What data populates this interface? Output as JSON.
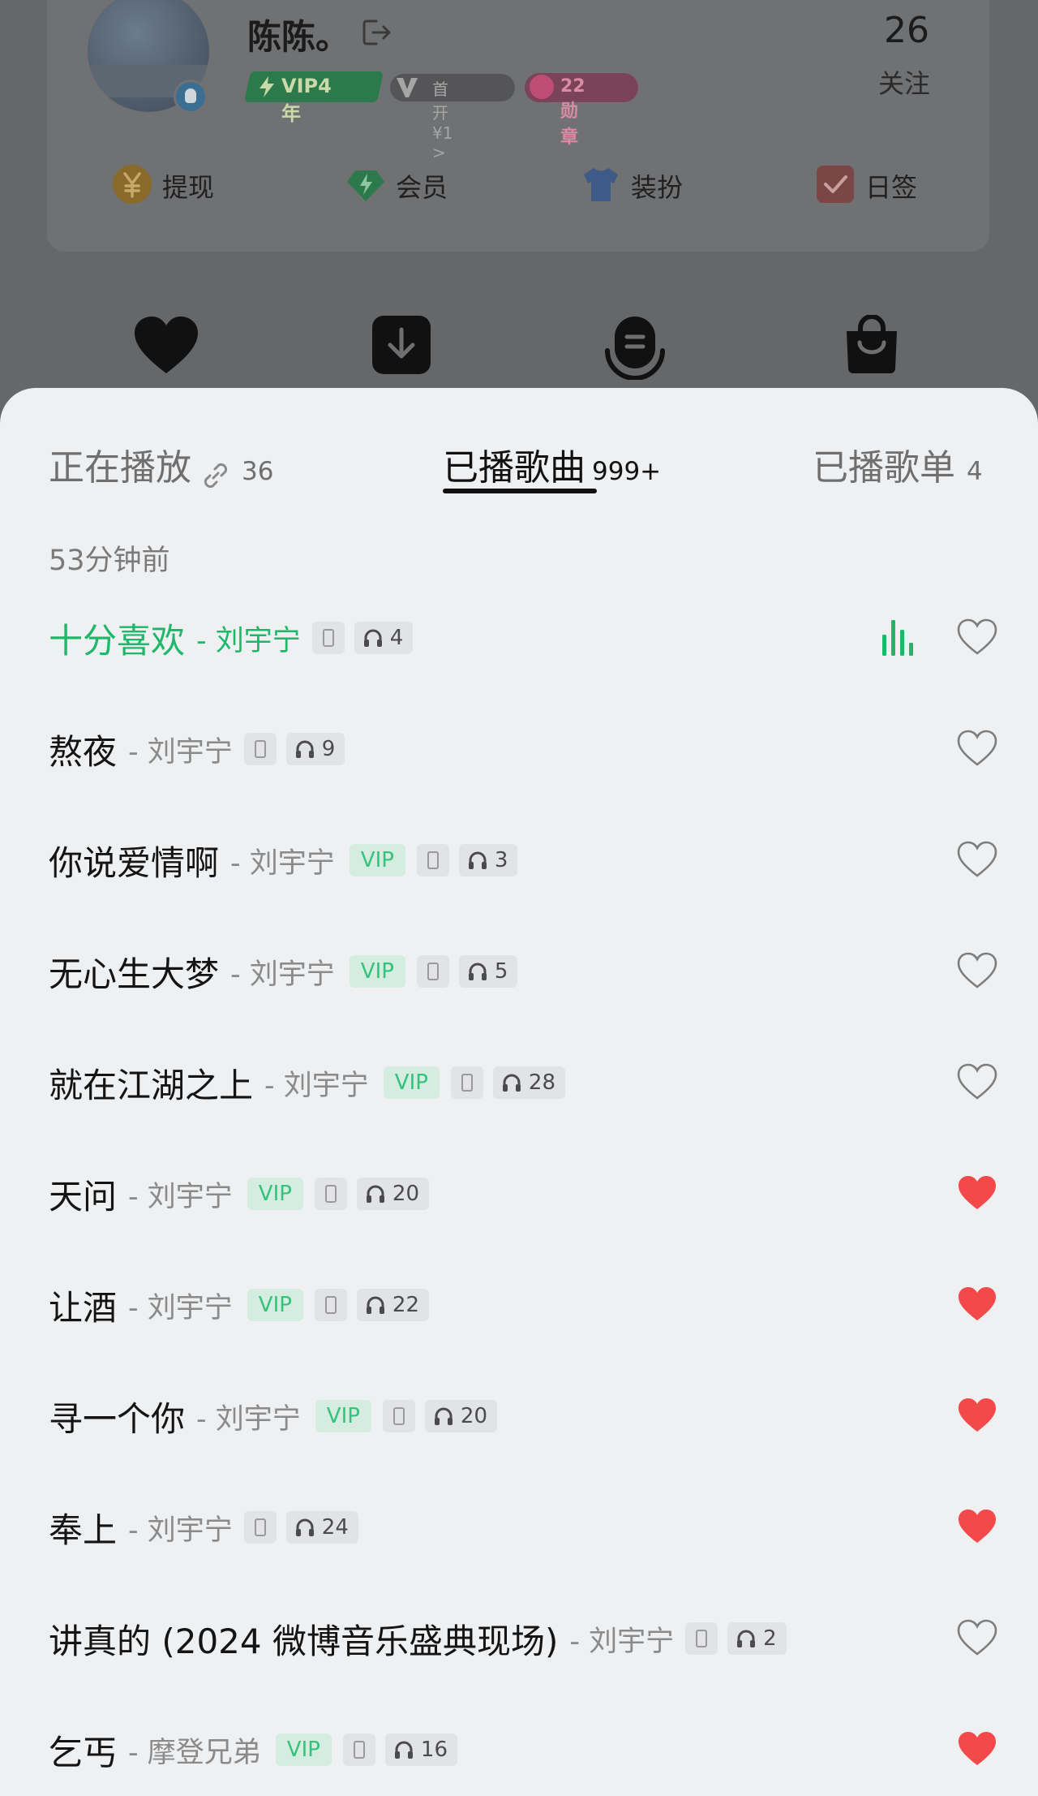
{
  "profile": {
    "username": "陈陈。",
    "vip_badge": "VIP4年",
    "v_badge": "首开¥1 >",
    "medal_badge": "22 勋章",
    "follow_count": "26",
    "follow_label": "关注"
  },
  "quick_actions": [
    {
      "label": "提现",
      "icon": "yuan-coin-icon"
    },
    {
      "label": "会员",
      "icon": "diamond-icon"
    },
    {
      "label": "装扮",
      "icon": "tshirt-icon"
    },
    {
      "label": "日签",
      "icon": "checkbox-icon"
    }
  ],
  "nav_icons": [
    "heart-icon",
    "download-icon",
    "podcast-icon",
    "shopping-bag-icon"
  ],
  "tabs": [
    {
      "label": "正在播放",
      "count": "36"
    },
    {
      "label": "已播歌曲",
      "count": "999+",
      "active": true
    },
    {
      "label": "已播歌单",
      "count": "4"
    }
  ],
  "time_label": "53分钟前",
  "songs": [
    {
      "title": "十分喜欢",
      "artist": "- 刘宇宁",
      "vip": false,
      "plays": "4",
      "liked": false,
      "playing": true
    },
    {
      "title": "熬夜",
      "artist": "- 刘宇宁",
      "vip": false,
      "plays": "9",
      "liked": false
    },
    {
      "title": "你说爱情啊",
      "artist": "- 刘宇宁",
      "vip": true,
      "plays": "3",
      "liked": false
    },
    {
      "title": "无心生大梦",
      "artist": "- 刘宇宁",
      "vip": true,
      "plays": "5",
      "liked": false
    },
    {
      "title": "就在江湖之上",
      "artist": "- 刘宇宁",
      "vip": true,
      "plays": "28",
      "liked": false
    },
    {
      "title": "天问",
      "artist": "- 刘宇宁",
      "vip": true,
      "plays": "20",
      "liked": true
    },
    {
      "title": "让酒",
      "artist": "- 刘宇宁",
      "vip": true,
      "plays": "22",
      "liked": true
    },
    {
      "title": "寻一个你",
      "artist": "- 刘宇宁",
      "vip": true,
      "plays": "20",
      "liked": true
    },
    {
      "title": "奉上",
      "artist": "- 刘宇宁",
      "vip": false,
      "plays": "24",
      "liked": true
    },
    {
      "title": "讲真的 (2024 微博音乐盛典现场)",
      "artist": "- 刘宇宁",
      "vip": false,
      "plays": "2",
      "liked": false
    },
    {
      "title": "乞丐",
      "artist": "- 摩登兄弟",
      "vip": true,
      "plays": "16",
      "liked": true
    }
  ],
  "vip_tag_label": "VIP",
  "colors": {
    "accent_green": "#1fb76a",
    "heart_red": "#f4494a",
    "vip_tag_bg": "#d5ece0"
  }
}
